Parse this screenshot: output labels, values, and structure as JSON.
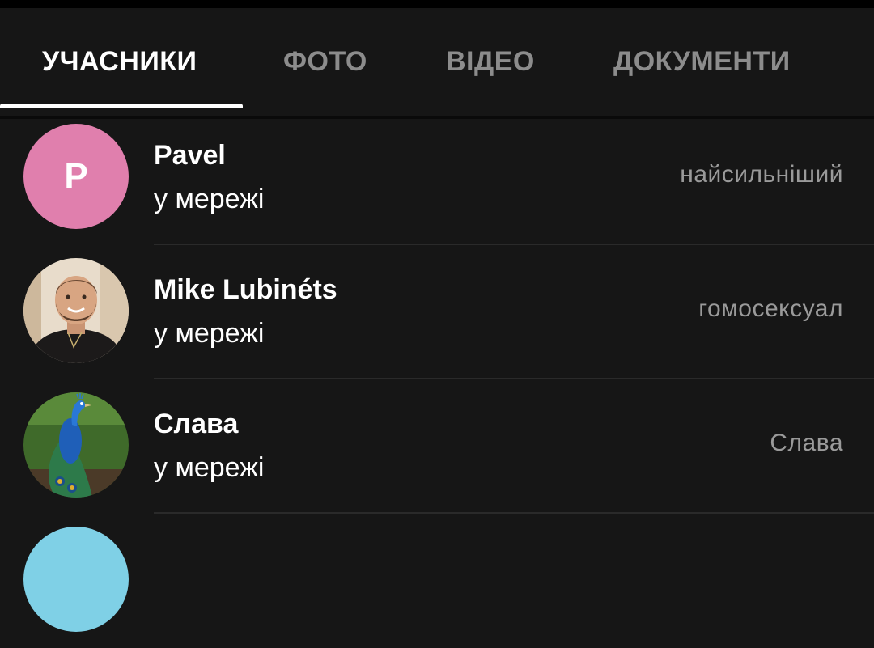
{
  "tabs": [
    {
      "label": "УЧАСНИКИ",
      "active": true
    },
    {
      "label": "ФОТО",
      "active": false
    },
    {
      "label": "ВІДЕО",
      "active": false
    },
    {
      "label": "ДОКУМЕНТИ",
      "active": false
    }
  ],
  "members": [
    {
      "name": "Pavel",
      "status": "у мережі",
      "role": "найсильніший",
      "avatar_letter": "P",
      "avatar_color": "#e07fad",
      "avatar_kind": "letter"
    },
    {
      "name": "Mike Lubinéts",
      "status": "у мережі",
      "role": "гомосексуал",
      "avatar_letter": "",
      "avatar_color": "",
      "avatar_kind": "photo-man-beard"
    },
    {
      "name": "Слава",
      "status": "у мережі",
      "role": "Слава",
      "avatar_letter": "",
      "avatar_color": "",
      "avatar_kind": "photo-peacock"
    },
    {
      "name": "",
      "status": "",
      "role": "",
      "avatar_letter": "",
      "avatar_color": "#7fd0e6",
      "avatar_kind": "partial-letter"
    }
  ],
  "colors": {
    "background": "#161616",
    "active_tab": "#ffffff",
    "inactive_tab": "#8c8c8c",
    "role_text": "#9a9a9a"
  }
}
